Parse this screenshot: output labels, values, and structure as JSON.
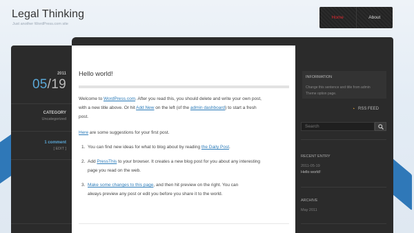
{
  "header": {
    "title": "Legal Thinking",
    "tagline": "Just another WordPress.com site",
    "nav": [
      {
        "label": "Home",
        "active": true
      },
      {
        "label": "About",
        "active": false
      }
    ]
  },
  "post_meta": {
    "year": "2011",
    "month": "05",
    "day": "/19",
    "category_label": "CATEGORY",
    "category_value": "Uncategorized",
    "comments": "1 comment",
    "edit": "[ EDIT ]"
  },
  "post": {
    "title": "Hello world!",
    "p1": {
      "t1": "Welcome to ",
      "link1": "WordPress.com",
      "t2": ". After you read this, you should delete and write your own post,",
      "line2a": "with a new title above. Or hit ",
      "link2": "Add New",
      "line2b": " on the left (of the ",
      "link3": "admin dashboard",
      "line2c": ") to start a fresh",
      "line3": "post."
    },
    "p2": {
      "link": "Here",
      "text": " are some suggestions for your first post."
    },
    "list": [
      {
        "num": "1.",
        "pre": "You can find new ideas for what to blog about by reading ",
        "link": "the Daily Post",
        "post": "."
      },
      {
        "num": "2.",
        "pre": "Add ",
        "link": "PressThis",
        "post": " to your browser. It creates a new blog post for you about any interesting",
        "line2": "page you read on the web."
      },
      {
        "num": "3.",
        "pre": "",
        "link": "Make some changes to this page",
        "post": ", and then hit preview on the right. You can",
        "line2": "always preview any post or edit you before you share it to the world."
      }
    ]
  },
  "sidebar": {
    "info_title": "INFORMATION",
    "info_text": "Change this sentence and title from admin Theme option page.",
    "rss": "RSS FEED",
    "search_placeholder": "Search",
    "recent_entry_heading": "RECENT ENTRY",
    "recent_entry_date": "2011-05-19",
    "recent_entry_title": "Hello world!",
    "archive_heading": "ARCHIVE",
    "archive_item": "May 2011"
  },
  "colors": {
    "accent_blue": "#2b7bb9",
    "date_blue": "#5aa7d6",
    "nav_active": "#e0282f",
    "dark_panel": "#2b2b2b"
  }
}
